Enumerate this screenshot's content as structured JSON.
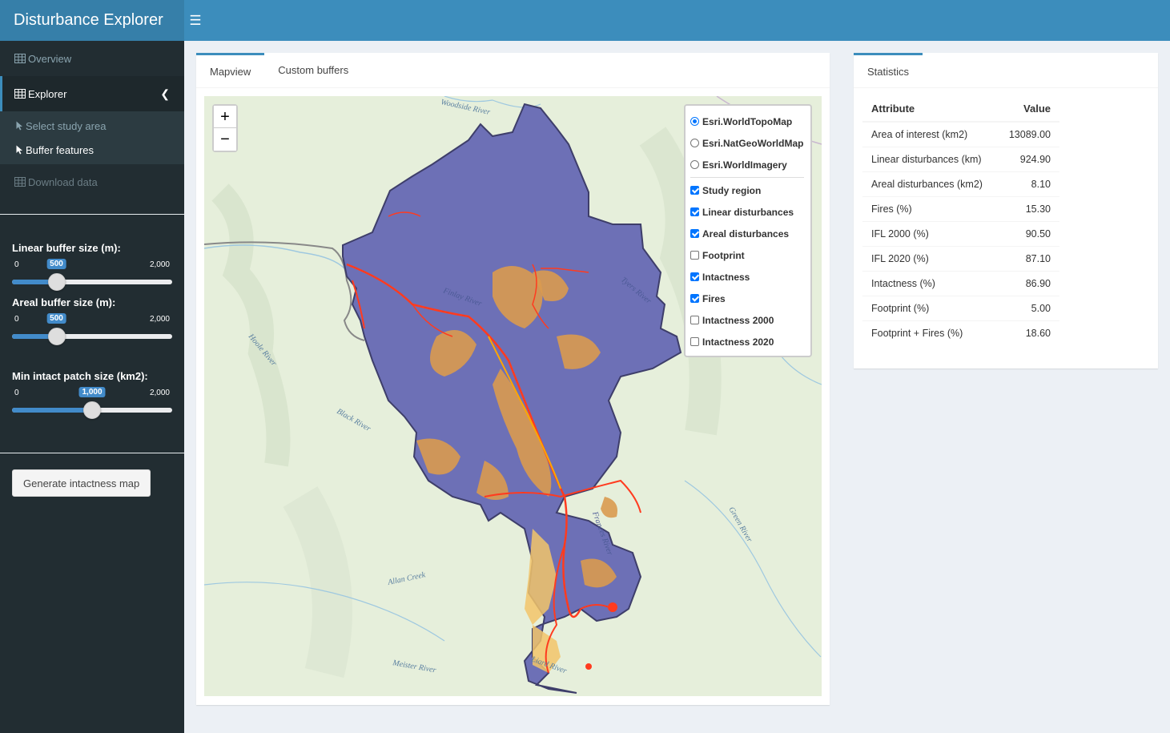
{
  "app": {
    "title": "Disturbance Explorer"
  },
  "sidebar": {
    "items": [
      {
        "label": "Overview",
        "icon": "table-icon"
      },
      {
        "label": "Explorer",
        "icon": "table-icon"
      },
      {
        "label": "Download data",
        "icon": "table-icon"
      }
    ],
    "subitems": [
      {
        "label": "Select study area",
        "icon": "cursor-icon"
      },
      {
        "label": "Buffer features",
        "icon": "cursor-icon"
      }
    ],
    "sliders": [
      {
        "label": "Linear buffer size (m):",
        "min": "0",
        "max": "2,000",
        "value_label": "500",
        "value": 500,
        "range": [
          0,
          2000
        ]
      },
      {
        "label": "Areal buffer size (m):",
        "min": "0",
        "max": "2,000",
        "value_label": "500",
        "value": 500,
        "range": [
          0,
          2000
        ]
      },
      {
        "label": "Min intact patch size (km2):",
        "min": "0",
        "max": "2,000",
        "value_label": "1,000",
        "value": 1000,
        "range": [
          0,
          2000
        ]
      }
    ],
    "generate_button": "Generate intactness map"
  },
  "main": {
    "tabs": [
      "Mapview",
      "Custom buffers"
    ],
    "zoom_in": "+",
    "zoom_out": "−",
    "basemaps": [
      {
        "label": "Esri.WorldTopoMap",
        "selected": true
      },
      {
        "label": "Esri.NatGeoWorldMap",
        "selected": false
      },
      {
        "label": "Esri.WorldImagery",
        "selected": false
      }
    ],
    "overlays": [
      {
        "label": "Study region",
        "checked": true
      },
      {
        "label": "Linear disturbances",
        "checked": true
      },
      {
        "label": "Areal disturbances",
        "checked": true
      },
      {
        "label": "Footprint",
        "checked": false
      },
      {
        "label": "Intactness",
        "checked": true
      },
      {
        "label": "Fires",
        "checked": true
      },
      {
        "label": "Intactness 2000",
        "checked": false
      },
      {
        "label": "Intactness 2020",
        "checked": false
      }
    ],
    "map_labels": [
      "Woodside River",
      "Hoole River",
      "Black River",
      "Allan Creek",
      "Meister River",
      "Liard River",
      "Green River",
      "Tyers River",
      "Finlay River",
      "Frances River"
    ]
  },
  "stats": {
    "tab": "Statistics",
    "headers": [
      "Attribute",
      "Value"
    ],
    "rows": [
      [
        "Area of interest (km2)",
        "13089.00"
      ],
      [
        "Linear disturbances (km)",
        "924.90"
      ],
      [
        "Areal disturbances (km2)",
        "8.10"
      ],
      [
        "Fires (%)",
        "15.30"
      ],
      [
        "IFL 2000 (%)",
        "90.50"
      ],
      [
        "IFL 2020 (%)",
        "87.10"
      ],
      [
        "Intactness (%)",
        "86.90"
      ],
      [
        "Footprint (%)",
        "5.00"
      ],
      [
        "Footprint + Fires (%)",
        "18.60"
      ]
    ]
  },
  "colors": {
    "header": "#3c8dbc",
    "logo": "#367fa9",
    "sidebar": "#222d32",
    "study_region": "#5c5fb0",
    "fires": "#d99a4f",
    "linear": "#ff0000",
    "footprint_road": "#ffa500"
  }
}
